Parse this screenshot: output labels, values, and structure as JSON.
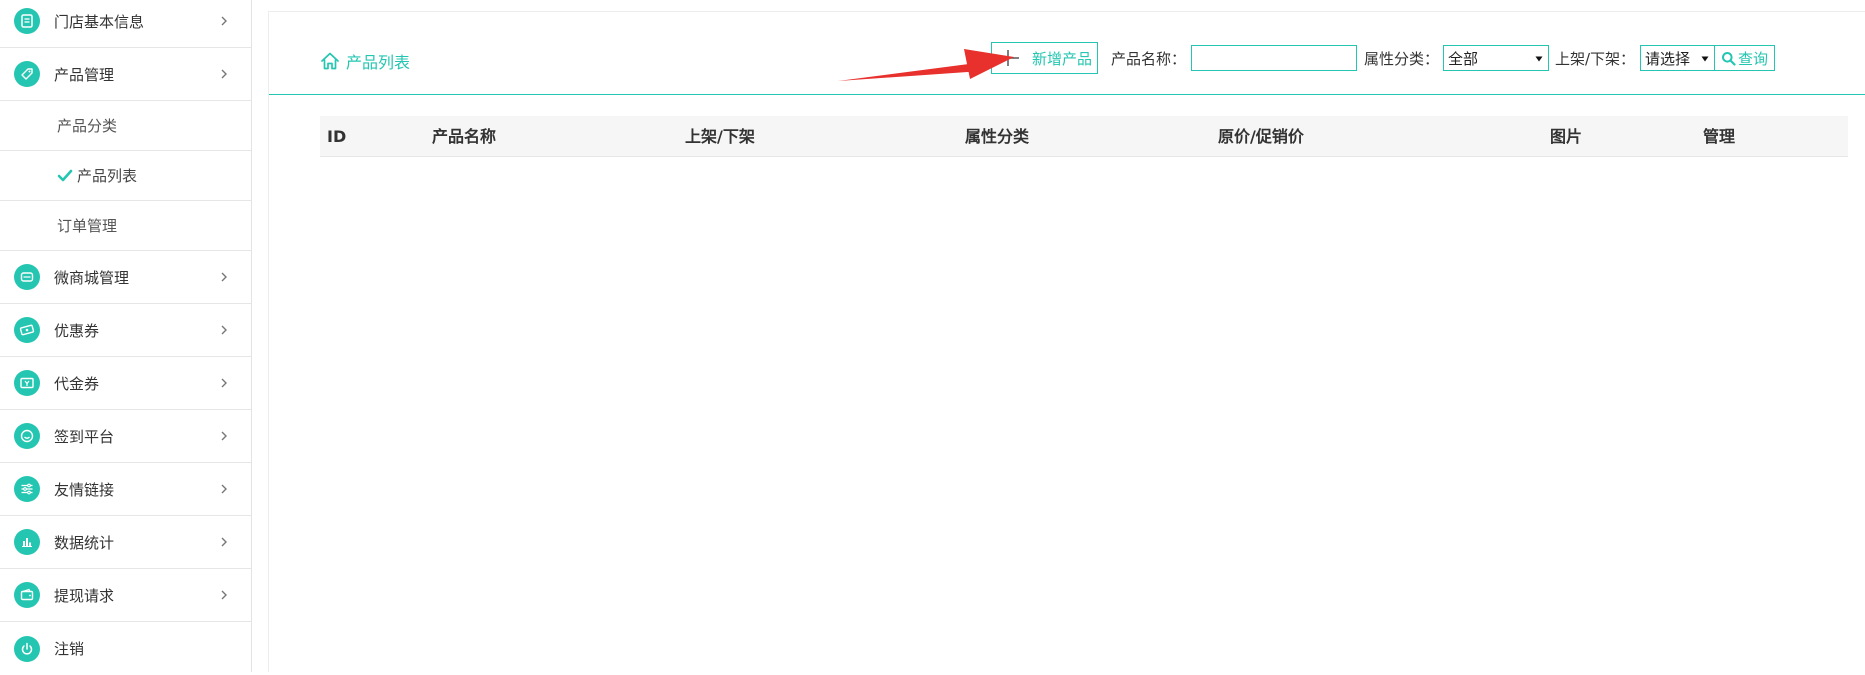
{
  "sidebar": {
    "items": [
      {
        "label": "门店基本信息",
        "icon": "document-icon"
      },
      {
        "label": "产品管理",
        "icon": "tag-icon"
      },
      {
        "label": "微商城管理",
        "icon": "store-icon"
      },
      {
        "label": "优惠券",
        "icon": "coupon-icon"
      },
      {
        "label": "代金券",
        "icon": "voucher-icon"
      },
      {
        "label": "签到平台",
        "icon": "smile-icon"
      },
      {
        "label": "友情链接",
        "icon": "sliders-icon"
      },
      {
        "label": "数据统计",
        "icon": "bar-chart-icon"
      },
      {
        "label": "提现请求",
        "icon": "wallet-icon"
      },
      {
        "label": "注销",
        "icon": "power-icon"
      }
    ],
    "subitems": [
      {
        "label": "产品分类"
      },
      {
        "label": "产品列表",
        "active": true
      },
      {
        "label": "订单管理"
      }
    ]
  },
  "breadcrumb": {
    "label": "产品列表"
  },
  "toolbar": {
    "add_label": "新增产品",
    "name_label": "产品名称：",
    "name_value": "",
    "category_label": "属性分类：",
    "category_value": "全部",
    "status_label": "上架/下架：",
    "status_value": "请选择",
    "search_label": "查询"
  },
  "table": {
    "columns": [
      "ID",
      "产品名称",
      "上架/下架",
      "属性分类",
      "原价/促销价",
      "图片",
      "管理"
    ],
    "rows": []
  },
  "colors": {
    "accent": "#24c6b1",
    "arrow": "#e8302c"
  }
}
